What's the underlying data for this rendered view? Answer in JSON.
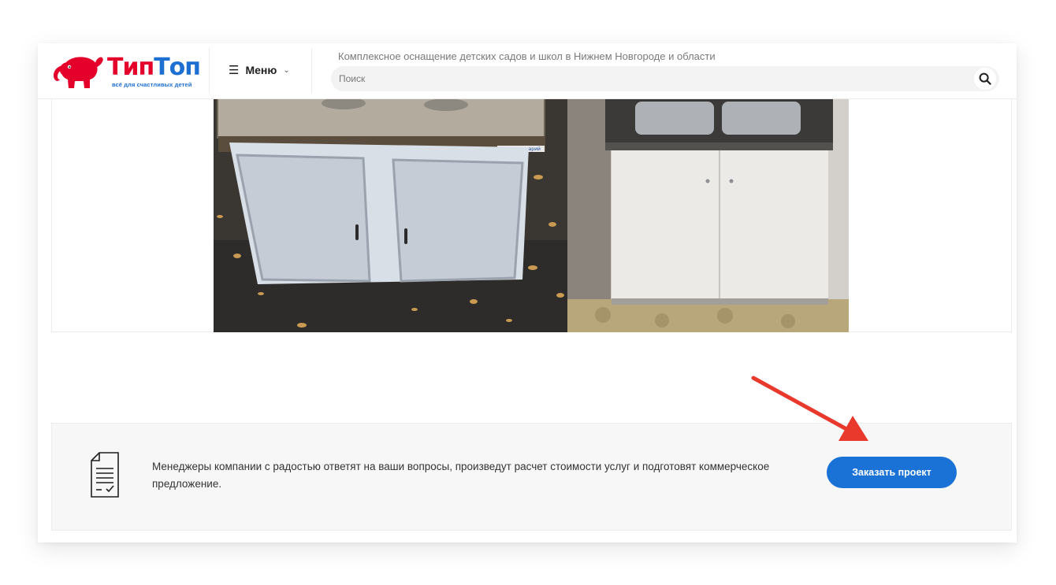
{
  "header": {
    "logo": {
      "text_red": "Тип",
      "text_blue": "Топ",
      "tagline": "всё для счастливых детей"
    },
    "menu_label": "Меню",
    "site_tagline": "Комплексное оснащение детских садов и школ в Нижнем Новгороде и области",
    "search": {
      "placeholder": "Поиск",
      "value": ""
    }
  },
  "gallery": {
    "photos": [
      {
        "label": "before-sink-cabinet",
        "sticker_text": "инструментарий"
      },
      {
        "label": "after-sink-cabinet"
      }
    ]
  },
  "cta": {
    "text": "Менеджеры компании с радостью ответят на ваши вопросы, произведут расчет стоимости услуг и подготовят коммерческое предложение.",
    "button_label": "Заказать проект"
  },
  "icons": {
    "menu": "hamburger-icon",
    "search": "search-icon",
    "cta": "document-check-icon",
    "chevron": "chevron-down-icon"
  },
  "colors": {
    "brand_red": "#e4002b",
    "brand_blue": "#1d6fd1",
    "button_blue": "#1b72d6",
    "annotation_arrow": "#e8392c",
    "panel_bg": "#f7f7f7"
  }
}
